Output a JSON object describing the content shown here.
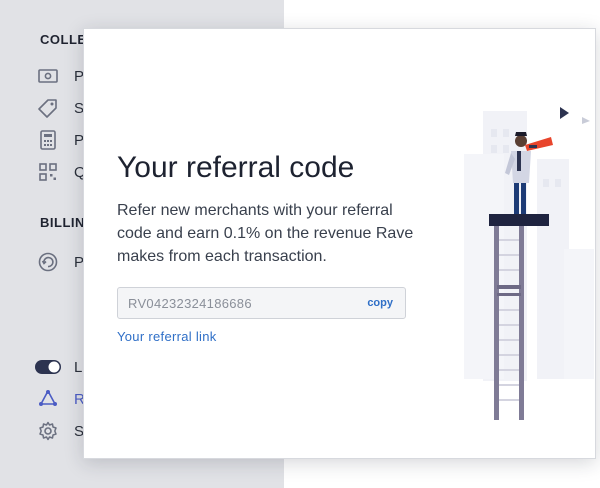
{
  "sidebar": {
    "section_collect": "COLLE",
    "collect_items": [
      {
        "label": "P",
        "icon": "cash-icon"
      },
      {
        "label": "S",
        "icon": "tag-icon"
      },
      {
        "label": "P",
        "icon": "calculator-icon"
      },
      {
        "label": "Q",
        "icon": "qr-code-icon"
      }
    ],
    "section_billing": "BILLIN",
    "billing_items": [
      {
        "label": "P",
        "icon": "recurring-icon"
      }
    ],
    "bottom_items": [
      {
        "label": "L",
        "icon": "toggle-icon"
      },
      {
        "label": "R",
        "icon": "referral-icon",
        "active": true
      },
      {
        "label": "S",
        "icon": "gear-icon"
      }
    ]
  },
  "modal": {
    "title": "Your referral code",
    "description": "Refer new merchants with your referral code and earn 0.1% on the revenue Rave makes from each transaction.",
    "referral_code": "RV04232324186686",
    "copy_label": "copy",
    "referral_link_label": "Your referral link",
    "illustration": "person-with-telescope-on-tower-illustration"
  },
  "colors": {
    "sidebar_bg": "#e1e2e6",
    "link": "#2f6fc7",
    "active_nav": "#4b5cc4",
    "tower": "#7f7b96",
    "flag": "#e8452c"
  }
}
